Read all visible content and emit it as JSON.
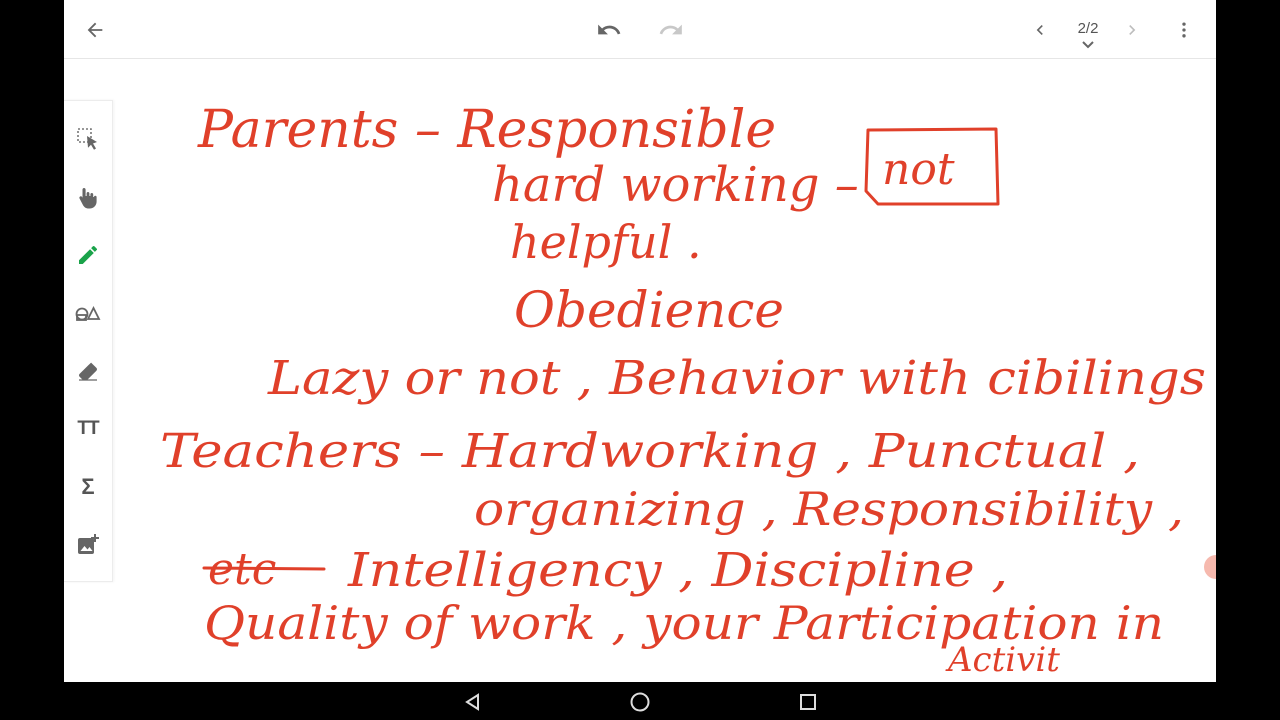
{
  "topbar": {
    "back_icon": "arrow-back-icon",
    "undo_icon": "undo-icon",
    "redo_icon": "redo-icon",
    "prev_icon": "chevron-left-icon",
    "page_indicator": "2/2",
    "next_icon": "chevron-right-icon",
    "more_icon": "more-vert-icon"
  },
  "toolbar": {
    "tools": [
      {
        "name": "lasso-select-icon"
      },
      {
        "name": "hand-pan-icon"
      },
      {
        "name": "pen-icon",
        "active": true,
        "color": "#1aa34a"
      },
      {
        "name": "shapes-icon"
      },
      {
        "name": "eraser-icon"
      },
      {
        "name": "text-icon",
        "label": "TT"
      },
      {
        "name": "math-sigma-icon",
        "label": "Σ"
      },
      {
        "name": "add-image-icon"
      }
    ]
  },
  "notes": {
    "ink_color": "#e0402a",
    "lines": [
      "Parents – Responsible",
      "hard working –",
      "not",
      "helpful .",
      "Obedience",
      "Lazy or not , Behavior with cibilings",
      "Teachers – Hardworking , Punctual ,",
      "organizing , Responsibility ,",
      "etc",
      "Intelligency , Discipline ,",
      "Quality of work , your Participation in",
      "Activit"
    ]
  },
  "system_nav": {
    "back_icon": "triangle-back-icon",
    "home_icon": "circle-home-icon",
    "recents_icon": "square-recents-icon"
  }
}
